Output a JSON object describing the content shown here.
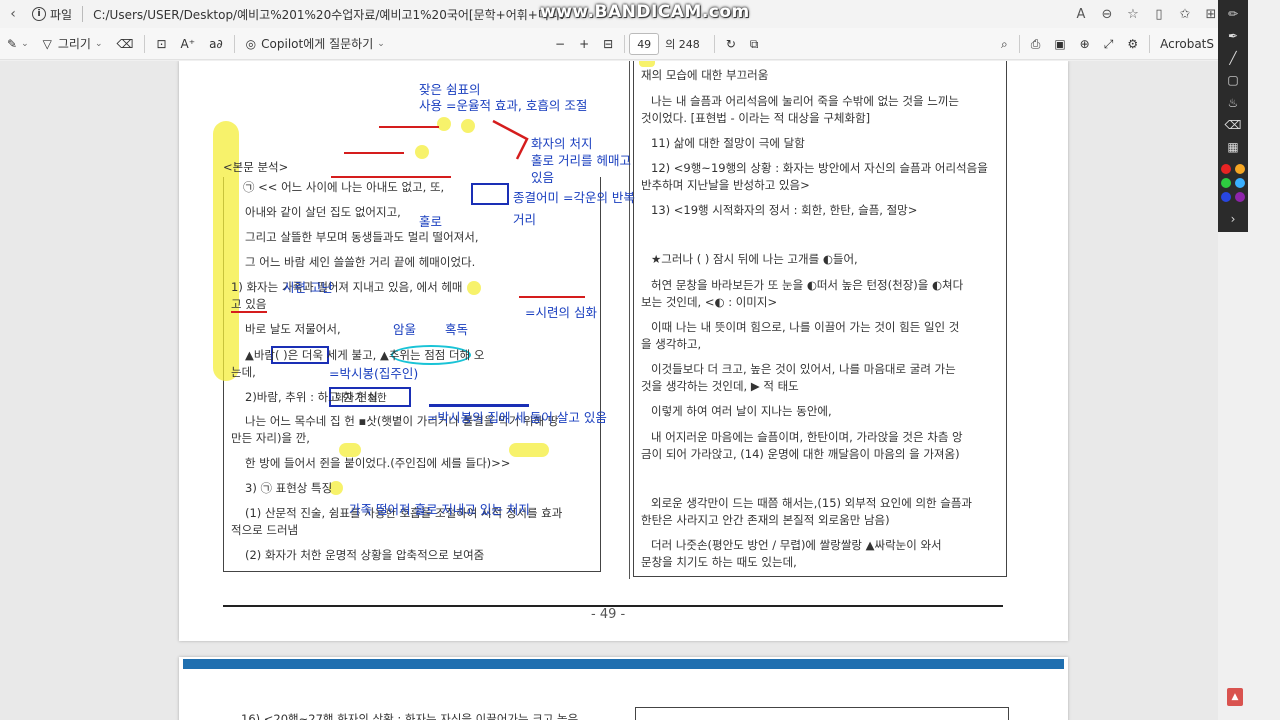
{
  "titlebar": {
    "file_label": "파일",
    "path": "C:/Users/USER/Desktop/예비고%201%20수업자료/예비고1%20국어[문학+어휘+미니모의].pdf",
    "watermark": "www.BANDICAM.com"
  },
  "pdf_toolbar": {
    "draw_label": "그리기",
    "copilot_label": "Copilot에게 질문하기",
    "page_current": "49",
    "page_total": "의 248",
    "acrobat_label": "AcrobatS"
  },
  "palette": {
    "colors": [
      "#e82323",
      "#f5a623",
      "#2ecc40",
      "#3ab0ff",
      "#2846e0",
      "#8e24aa"
    ]
  },
  "left_column": {
    "section_title": "<본문 분석>",
    "lines": [
      "㉠ << 어느 사이에 나는 아내도 없고, 또,",
      "아내와 같이 살던 집도 없어지고,",
      "그리고 살뜰한 부모며 동생들과도 멀리 떨어져서,",
      "그 어느 바람 세인 쓸쓸한 거리 끝에 헤매이었다.",
      "1)  화자는       가족과 떨어져       지내고 있음,         에서 헤매",
      "고 있음",
      "바로 날도 저물어서,",
      "▲바람(              )은 더욱 세게 불고, ▲추위는 점점 더해 오",
      "는데,",
      "2)바람, 추위 :                         하고        한 현실",
      "나는 어느 목수네 집 헌 ▪삿(햇볕이 가리거나 불결을 막기 위해 땅",
      "만든 자리)을 깐,",
      "한 방에 들어서 쥔을 붙이었다.(주인집에 세를 들다)>>",
      "3) ㉠ 표현상 특징",
      "(1) 산문적 진술, 쉼표를 사용한 호흡을 조절하여 시적 정서를 효과",
      "적으로 드러냄",
      "(2) 화자가 처한 운명적 상황을 압축적으로 보여줌"
    ],
    "boxed_phrase": "화자가 처한"
  },
  "right_column": {
    "lines": [
      "재의 모습에 대한 부끄러움",
      "나는 내 슬픔과 어리석음에 눌리어 죽을 수밖에 없는 것을 느끼는",
      "것이었다. [표현법 -      이라는      적 대상을 구체화함]",
      "11) 삶에 대한 절망이 극에 달함",
      "12) <9행~19행의 상황 : 화자는 방안에서 자신의 슬픔과 어리석음을",
      "반추하며 지난날을 반성하고 있음>",
      "13) <19행 시적화자의 정서 : 회한, 한탄, 슬픔, 절망>",
      "★그러나 (            ) 잠시 뒤에 나는 고개를 ◐들어,",
      "허연 문창을 바라보든가 또 눈을 ◐떠서 높은 턴정(천장)을 ◐쳐다",
      "보는 것인데, <◐ :         이미지>",
      "이때 나는 내 뜻이며 힘으로, 나를 이끌어 가는 것이 힘든 일인 것",
      "을 생각하고,",
      "이것들보다 더 크고, 높은 것이 있어서, 나를 마음대로 굴려 가는",
      "것을 생각하는 것인데, ▶        적 태도",
      "이렇게 하여 여러 날이 지나는 동안에,",
      "내 어지러운 마음에는 슬픔이며, 한탄이며, 가라앉을 것은 차츰 앙",
      "금이 되어 가라앉고, (14) 운명에 대한 깨달음이 마음의        을 가져옴)",
      "외로운 생각만이 드는 때쯤 해서는,(15) 외부적 요인에 의한 슬픔과",
      "한탄은 사라지고 안간 존재의 본질적 외로움만 남음)",
      "더러 나줏손(평안도 방언 /      무렵)에 쌀랑쌀랑 ▲싸락눈이 와서",
      "문창을 치기도 하는 때도 있는데,"
    ]
  },
  "annotations": {
    "a1": "잦은 쉼표의",
    "a2": "사용 =운율적 효과, 호흡의 조절",
    "a3": "화자의 처지",
    "a4": "홀로 거리를 헤매고",
    "a5": "있음",
    "a6": "종결어미 =각운의 반복",
    "a7": "홀로",
    "a8": "거리",
    "a9": "시련 고난",
    "a10": "=시련의 심화",
    "a11": "암울",
    "a12": "혹독",
    "a13": "=박시봉(집주인)",
    "a14": "=박시봉의 집에 세 들어 살고 있음",
    "a15": "가족 떨어져 홀로 지내고 있는 처지"
  },
  "footer": {
    "page_number": "- 49 -",
    "next_page_line": "16) <20행~27행 화자의 상황 : 화자는 자신을 이끌어가는 크고 높은"
  }
}
